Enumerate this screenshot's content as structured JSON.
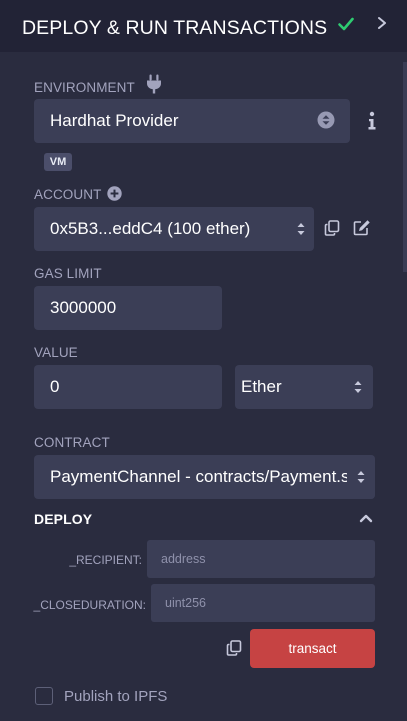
{
  "header": {
    "title": "DEPLOY & RUN TRANSACTIONS"
  },
  "environment": {
    "label": "ENVIRONMENT",
    "value": "Hardhat Provider",
    "badge": "VM"
  },
  "account": {
    "label": "ACCOUNT",
    "value": "0x5B3...eddC4 (100 ether)"
  },
  "gas_limit": {
    "label": "GAS LIMIT",
    "value": "3000000"
  },
  "value": {
    "label": "VALUE",
    "amount": "0",
    "unit": "Ether"
  },
  "contract": {
    "label": "CONTRACT",
    "value": "PaymentChannel - contracts/Payment.s"
  },
  "deploy": {
    "label": "DEPLOY",
    "params": [
      {
        "name": "_RECIPIENT:",
        "placeholder": "address"
      },
      {
        "name": "_CLOSEDURATION:",
        "placeholder": "uint256"
      }
    ],
    "transact_label": "transact"
  },
  "publish": {
    "label": "Publish to IPFS",
    "checked": false
  },
  "colors": {
    "accent_green": "#2ecc71",
    "transact_red": "#c64343",
    "panel_bg": "#2a2c3f",
    "header_bg": "#222336",
    "input_bg": "#3b3e56"
  }
}
